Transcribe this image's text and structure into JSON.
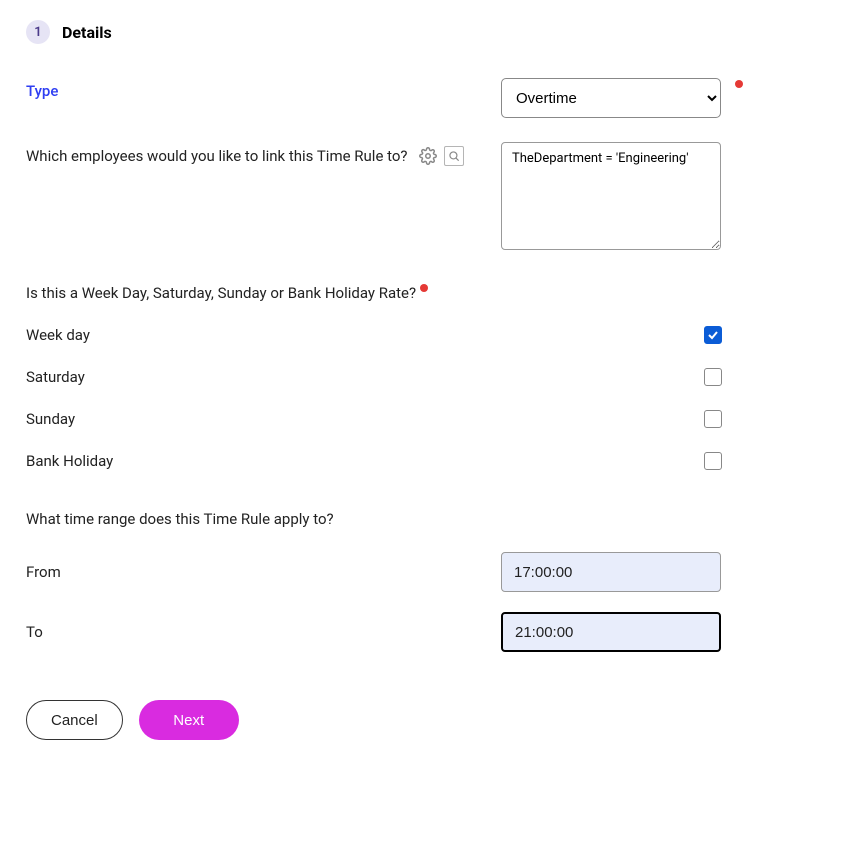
{
  "step": {
    "number": "1",
    "title": "Details"
  },
  "type": {
    "label": "Type",
    "selected": "Overtime"
  },
  "employee_link": {
    "question": "Which employees would you like to link this Time Rule to?",
    "value": "TheDepartment = 'Engineering'"
  },
  "rate_question": "Is this a Week Day, Saturday, Sunday or Bank Holiday Rate?",
  "days": {
    "weekday": {
      "label": "Week day",
      "checked": true
    },
    "saturday": {
      "label": "Saturday",
      "checked": false
    },
    "sunday": {
      "label": "Sunday",
      "checked": false
    },
    "bank_holiday": {
      "label": "Bank Holiday",
      "checked": false
    }
  },
  "time_range": {
    "question": "What time range does this Time Rule apply to?",
    "from_label": "From",
    "from_value": "17:00:00",
    "to_label": "To",
    "to_value": "21:00:00"
  },
  "buttons": {
    "cancel": "Cancel",
    "next": "Next"
  }
}
